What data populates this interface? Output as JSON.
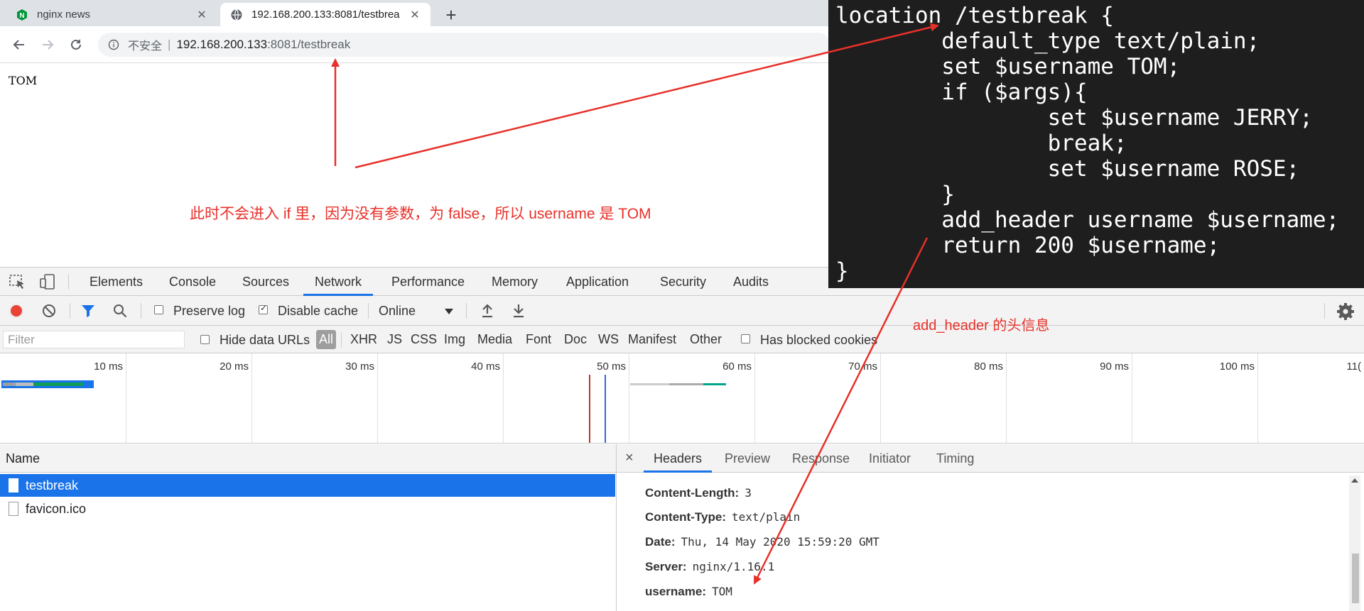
{
  "browser": {
    "tabs": [
      {
        "title": "nginx news",
        "favicon": "nginx-logo-icon",
        "active": false
      },
      {
        "title": "192.168.200.133:8081/testbrea",
        "favicon": "globe-icon",
        "active": true
      }
    ],
    "new_tab": "+",
    "omnibox": {
      "security": "不安全",
      "separator": "|",
      "host": "192.168.200.133",
      "path": ":8081/testbreak"
    }
  },
  "page": {
    "body_text": "TOM"
  },
  "devtools": {
    "tabs": [
      "Elements",
      "Console",
      "Sources",
      "Network",
      "Performance",
      "Memory",
      "Application",
      "Security",
      "Audits"
    ],
    "selected_tab": "Network",
    "toolbar": {
      "preserve_log": {
        "label": "Preserve log",
        "checked": false
      },
      "disable_cache": {
        "label": "Disable cache",
        "checked": true
      },
      "throttling": "Online"
    },
    "filter": {
      "placeholder": "Filter",
      "hide_data_urls": {
        "label": "Hide data URLs",
        "checked": false
      },
      "types": [
        "All",
        "XHR",
        "JS",
        "CSS",
        "Img",
        "Media",
        "Font",
        "Doc",
        "WS",
        "Manifest",
        "Other"
      ],
      "selected_type": "All",
      "has_blocked_cookies": {
        "label": "Has blocked cookies",
        "checked": false
      }
    },
    "overview": {
      "ticks": [
        "10 ms",
        "20 ms",
        "30 ms",
        "40 ms",
        "50 ms",
        "60 ms",
        "70 ms",
        "80 ms",
        "90 ms",
        "100 ms",
        "11("
      ]
    },
    "requests": {
      "column": "Name",
      "rows": [
        {
          "name": "testbreak",
          "selected": true
        },
        {
          "name": "favicon.ico",
          "selected": false
        }
      ]
    },
    "detail": {
      "close": "×",
      "tabs": [
        "Headers",
        "Preview",
        "Response",
        "Initiator",
        "Timing"
      ],
      "selected_tab": "Headers",
      "headers": [
        {
          "key": "Content-Length:",
          "value": "3"
        },
        {
          "key": "Content-Type:",
          "value": "text/plain"
        },
        {
          "key": "Date:",
          "value": "Thu, 14 May 2020 15:59:20 GMT"
        },
        {
          "key": "Server:",
          "value": "nginx/1.16.1"
        },
        {
          "key": "username:",
          "value": "TOM"
        }
      ]
    }
  },
  "annotations": {
    "code": [
      "location /testbreak {",
      "        default_type text/plain;",
      "        set $username TOM;",
      "        if ($args){",
      "                set $username JERRY;",
      "                break;",
      "                set $username ROSE;",
      "        }",
      "        add_header username $username;",
      "        return 200 $username;",
      "}"
    ],
    "note_main": "此时不会进入 if 里，因为没有参数，为 false，所以 username 是 TOM",
    "note_header": "add_header 的头信息",
    "color": "#e8302a"
  }
}
